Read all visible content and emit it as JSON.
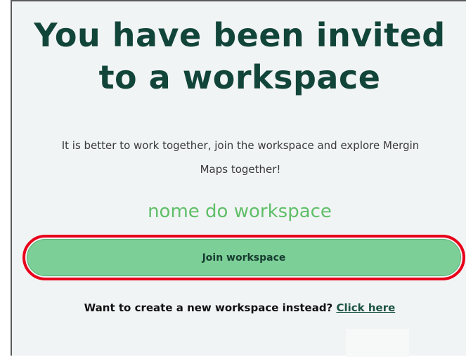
{
  "invite": {
    "title_line1": "You have been invited",
    "title_line2": "to a workspace",
    "description_line1": "It is better to work together, join the workspace and explore Mergin",
    "description_line2": "Maps together!",
    "workspace_name": "nome do workspace",
    "join_button_label": "Join workspace",
    "create_prompt": "Want to create a new workspace instead?",
    "create_link_label": "Click here"
  },
  "colors": {
    "title": "#12453a",
    "workspace_name": "#5fbf69",
    "button_bg": "#7ccf96",
    "highlight_ring": "#e8001a",
    "panel_bg": "#f1f4f4"
  }
}
